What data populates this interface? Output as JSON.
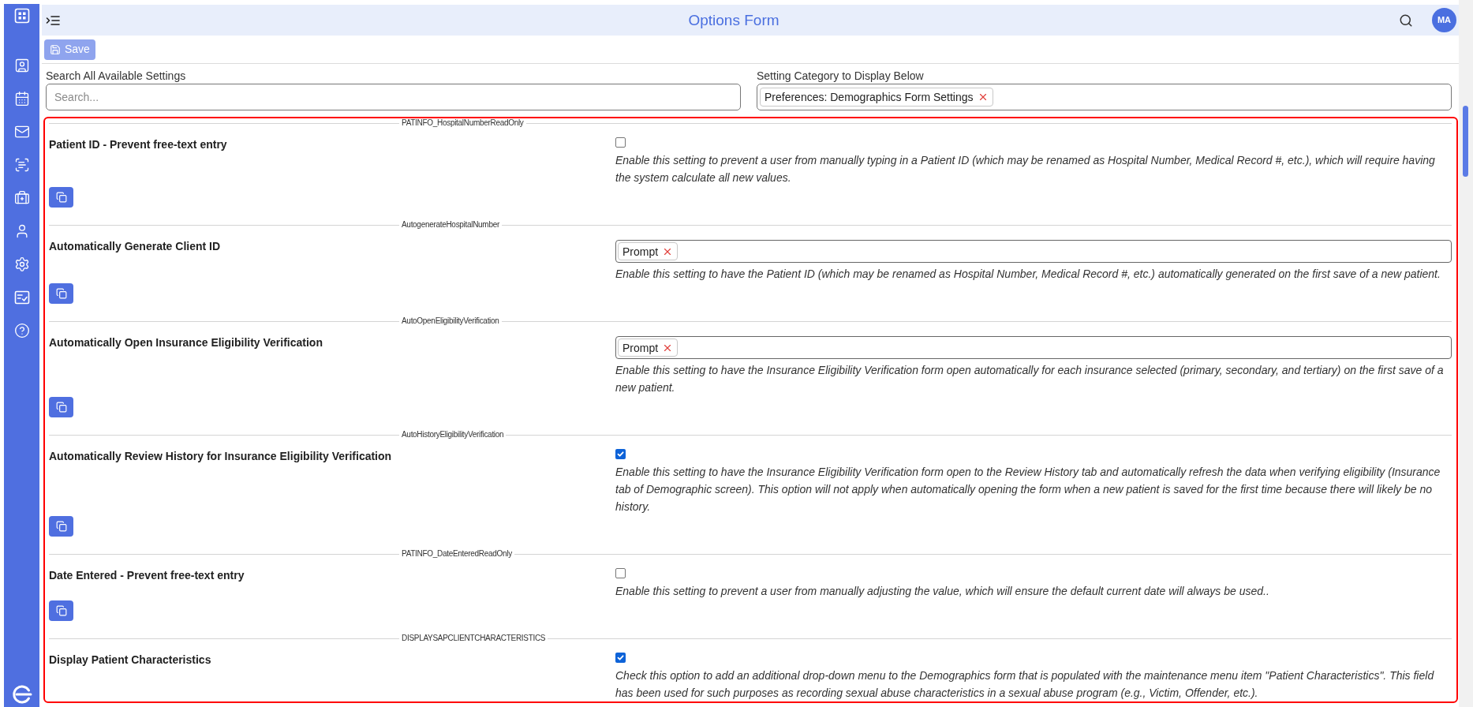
{
  "header": {
    "title": "Options Form",
    "avatar": "MA"
  },
  "toolbar": {
    "save_button": {
      "label": "Save",
      "disabled": true
    }
  },
  "filters": {
    "search": {
      "label": "Search All Available Settings",
      "placeholder": "Search..."
    },
    "category": {
      "label": "Setting Category to Display Below",
      "chips": [
        "Preferences: Demographics Form Settings"
      ]
    }
  },
  "settings": [
    {
      "code": "PATINFO_HospitalNumberReadOnly",
      "title": "Patient ID - Prevent free-text entry",
      "kind": "checkbox",
      "checked": false,
      "description": "Enable this setting to prevent a user from manually typing in a Patient ID (which may be renamed as Hospital Number, Medical Record #, etc.), which will require having the system calculate all new values.",
      "copy_button": true
    },
    {
      "code": "AutogenerateHospitalNumber",
      "title": "Automatically Generate Client ID",
      "kind": "select",
      "chips": [
        "Prompt"
      ],
      "description": "Enable this setting to have the Patient ID (which may be renamed as Hospital Number, Medical Record #, etc.) automatically generated on the first save of a new patient.",
      "copy_button": true
    },
    {
      "code": "AutoOpenEligibilityVerification",
      "title": "Automatically Open Insurance Eligibility Verification",
      "kind": "select",
      "chips": [
        "Prompt"
      ],
      "description": "Enable this setting to have the Insurance Eligibility Verification form open automatically for each insurance selected (primary, secondary, and tertiary) on the first save of a new patient.",
      "copy_button": true
    },
    {
      "code": "AutoHistoryEligibilityVerification",
      "title": "Automatically Review History for Insurance Eligibility Verification",
      "kind": "checkbox",
      "checked": true,
      "description": "Enable this setting to have the Insurance Eligibility Verification form open to the Review History tab and automatically refresh the data when verifying eligibility (Insurance tab of Demographic screen). This option will not apply when automatically opening the form when a new patient is saved for the first time because there will likely be no history.",
      "copy_button": true
    },
    {
      "code": "PATINFO_DateEnteredReadOnly",
      "title": "Date Entered - Prevent free-text entry",
      "kind": "checkbox",
      "checked": false,
      "description": "Enable this setting to prevent a user from manually adjusting the value, which will ensure the default current date will always be used..",
      "copy_button": true
    },
    {
      "code": "DISPLAYSAPCLIENTCHARACTERISTICS",
      "title": "Display Patient Characteristics",
      "kind": "checkbox",
      "checked": true,
      "description": "Check this option to add an additional drop-down menu to the Demographics form that is populated with the maintenance menu item \"Patient Characteristics\". This field has been used for such purposes as recording sexual abuse characteristics in a sexual abuse program (e.g., Victim, Offender, etc.).",
      "copy_button": false
    }
  ]
}
